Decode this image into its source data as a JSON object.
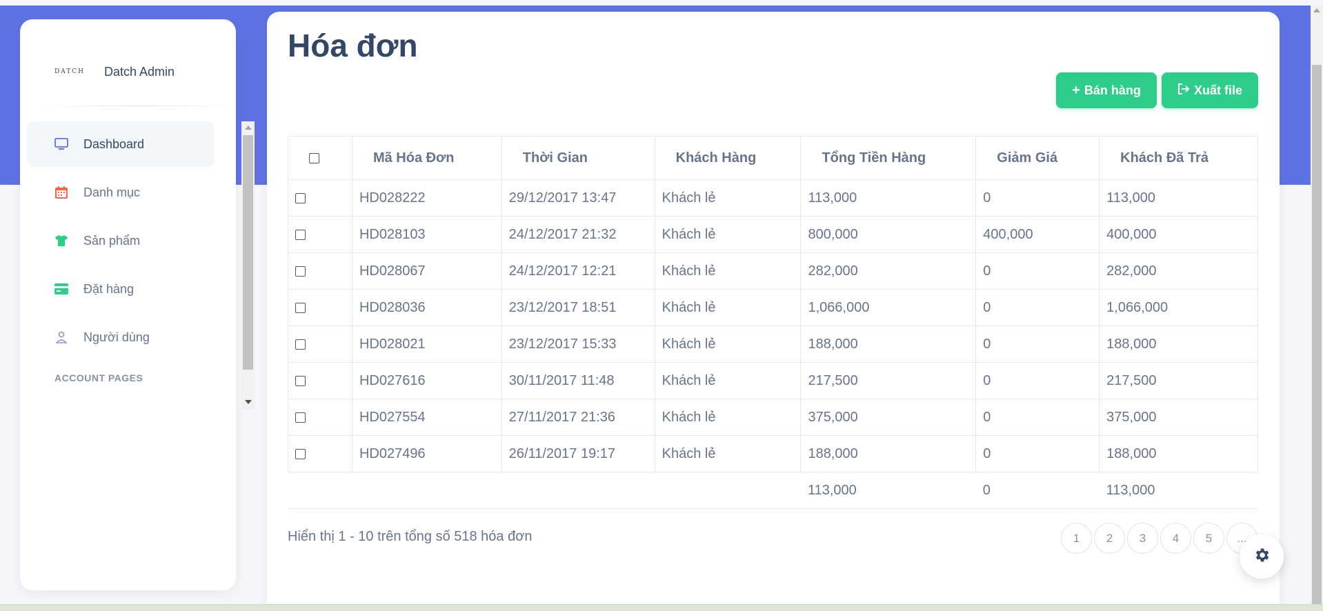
{
  "sidebar": {
    "brand_logo": "DATCH",
    "brand_name": "Datch Admin",
    "items": [
      {
        "label": "Dashboard",
        "icon": "monitor-icon"
      },
      {
        "label": "Danh mục",
        "icon": "calendar-icon"
      },
      {
        "label": "Sản phẩm",
        "icon": "tshirt-icon"
      },
      {
        "label": "Đặt hàng",
        "icon": "credit-card-icon"
      },
      {
        "label": "Người dùng",
        "icon": "user-icon"
      }
    ],
    "section_heading": "ACCOUNT PAGES"
  },
  "main": {
    "title": "Hóa đơn",
    "buttons": {
      "sell_label": "Bán hàng",
      "export_label": "Xuất file"
    },
    "table": {
      "headers": [
        "Mã Hóa Đơn",
        "Thời Gian",
        "Khách Hàng",
        "Tổng Tiền Hàng",
        "Giảm Giá",
        "Khách Đã Trả"
      ],
      "rows": [
        [
          "HD028222",
          "29/12/2017 13:47",
          "Khách lẻ",
          "113,000",
          "0",
          "113,000"
        ],
        [
          "HD028103",
          "24/12/2017 21:32",
          "Khách lẻ",
          "800,000",
          "400,000",
          "400,000"
        ],
        [
          "HD028067",
          "24/12/2017 12:21",
          "Khách lẻ",
          "282,000",
          "0",
          "282,000"
        ],
        [
          "HD028036",
          "23/12/2017 18:51",
          "Khách lẻ",
          "1,066,000",
          "0",
          "1,066,000"
        ],
        [
          "HD028021",
          "23/12/2017 15:33",
          "Khách lẻ",
          "188,000",
          "0",
          "188,000"
        ],
        [
          "HD027616",
          "30/11/2017 11:48",
          "Khách lẻ",
          "217,500",
          "0",
          "217,500"
        ],
        [
          "HD027554",
          "27/11/2017 21:36",
          "Khách lẻ",
          "375,000",
          "0",
          "375,000"
        ],
        [
          "HD027496",
          "26/11/2017 19:17",
          "Khách lẻ",
          "188,000",
          "0",
          "188,000"
        ]
      ],
      "totals": {
        "total": "113,000",
        "discount": "0",
        "paid": "113,000"
      }
    },
    "summary": "Hiển thị 1 - 10 trên tổng số 518 hóa đơn",
    "pagination": [
      "1",
      "2",
      "3",
      "4",
      "5",
      "..."
    ]
  },
  "colors": {
    "accent": "#5e72e4",
    "success": "#2dce89",
    "text": "#344767",
    "muted": "#67748e"
  }
}
